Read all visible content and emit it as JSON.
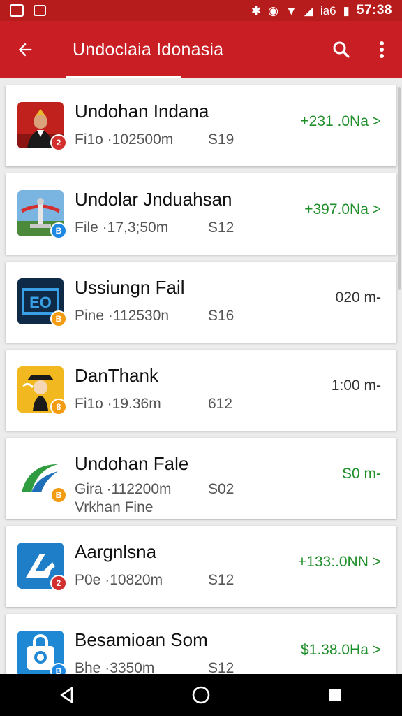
{
  "status_bar": {
    "time": "57:38",
    "carrier_text": "iа6"
  },
  "header": {
    "title": "Undoclaia Idonasia"
  },
  "items": [
    {
      "name": "Undohan Indana",
      "sub": "Fi1o ·102500m",
      "count": "S19",
      "price": "+231 .0Na >",
      "price_style": "green",
      "icon": "portrait-icon",
      "badge": "2",
      "badge_color": "red"
    },
    {
      "name": "Undolar Jnduahsan",
      "sub": "File ·17,3;50m",
      "count": "S12",
      "price": "+397.0Na >",
      "price_style": "green",
      "icon": "monument-icon",
      "badge": "B",
      "badge_color": "blue"
    },
    {
      "name": "Ussiungn Fail",
      "sub": "Pine ·112530n",
      "count": "S16",
      "price": "020 m-",
      "price_style": "gray",
      "icon": "eo-logo-icon",
      "badge": "B",
      "badge_color": "orange"
    },
    {
      "name": "DanThank",
      "sub": "Fi1o ·19.36m",
      "count": "612",
      "price": "1:00 m-",
      "price_style": "gray",
      "icon": "cartoon-icon",
      "badge": "8",
      "badge_color": "orange"
    },
    {
      "name": "Undohan Fale",
      "sub": "Gira ·112200m",
      "sub2": "Vrkhan Fine",
      "count": "S02",
      "price": "S0 m-",
      "price_style": "green",
      "icon": "swoosh-icon",
      "badge": "B",
      "badge_color": "orange"
    },
    {
      "name": "Aargnlsna",
      "sub": "P0e ·10820m",
      "count": "S12",
      "price": "+133:.0NN >",
      "price_style": "green",
      "icon": "arrow-logo-icon",
      "badge": "2",
      "badge_color": "red"
    },
    {
      "name": "Besamioan Som",
      "sub": "Bhe ·3350m",
      "count": "S12",
      "price": "$1.38.0Ha >",
      "price_style": "green",
      "icon": "bag-icon",
      "badge": "B",
      "badge_color": "blue"
    }
  ]
}
